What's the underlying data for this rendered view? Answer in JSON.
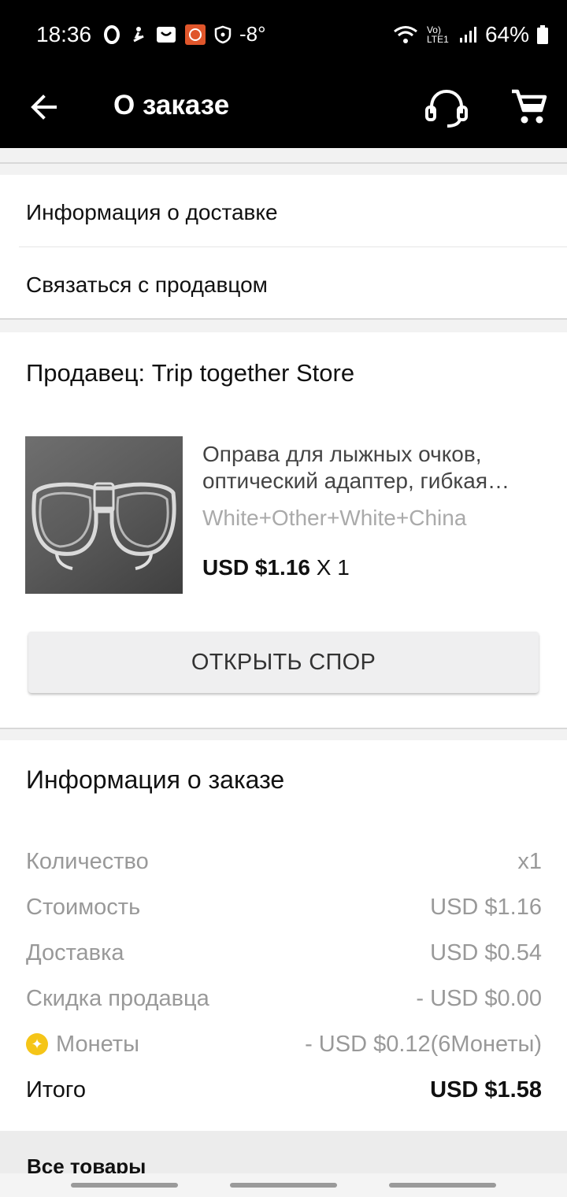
{
  "status_bar": {
    "time": "18:36",
    "temperature": "-8°",
    "battery": "64%",
    "icons": [
      "opera-icon",
      "snowboard-icon",
      "aliexpress-icon",
      "app-icon",
      "shield-icon",
      "wifi-icon",
      "volte-icon",
      "signal-icon",
      "battery-icon"
    ],
    "network_label": "Vo) LTE1"
  },
  "app_bar": {
    "title": "О заказе",
    "back_icon": "arrow-left-icon",
    "support_icon": "headset-icon",
    "cart_icon": "cart-icon"
  },
  "links": {
    "delivery_info": "Информация о доставке",
    "contact_seller": "Связаться с продавцом"
  },
  "seller": {
    "label": "Продавец: Trip together Store"
  },
  "product": {
    "title_line1": "Оправа для лыжных очков,",
    "title_line2": "оптический адаптер, гибкая…",
    "variant": "White+Other+White+China",
    "price": "USD $1.16",
    "qty": "X 1"
  },
  "dispute_button": "ОТКРЫТЬ СПОР",
  "order_info": {
    "title": "Информация о заказе",
    "rows": [
      {
        "label": "Количество",
        "value": "x1"
      },
      {
        "label": "Стоимость",
        "value": "USD $1.16"
      },
      {
        "label": "Доставка",
        "value": "USD $0.54"
      },
      {
        "label": "Скидка продавца",
        "value": "- USD $0.00"
      },
      {
        "label": "Монеты",
        "value": "- USD $0.12(6Монеты)"
      }
    ],
    "total_label": "Итого",
    "total_value": "USD $1.58"
  },
  "all_goods": "Все товары",
  "colors": {
    "header_bg": "#000000",
    "coin": "#f5c518",
    "muted_text": "#999999"
  }
}
